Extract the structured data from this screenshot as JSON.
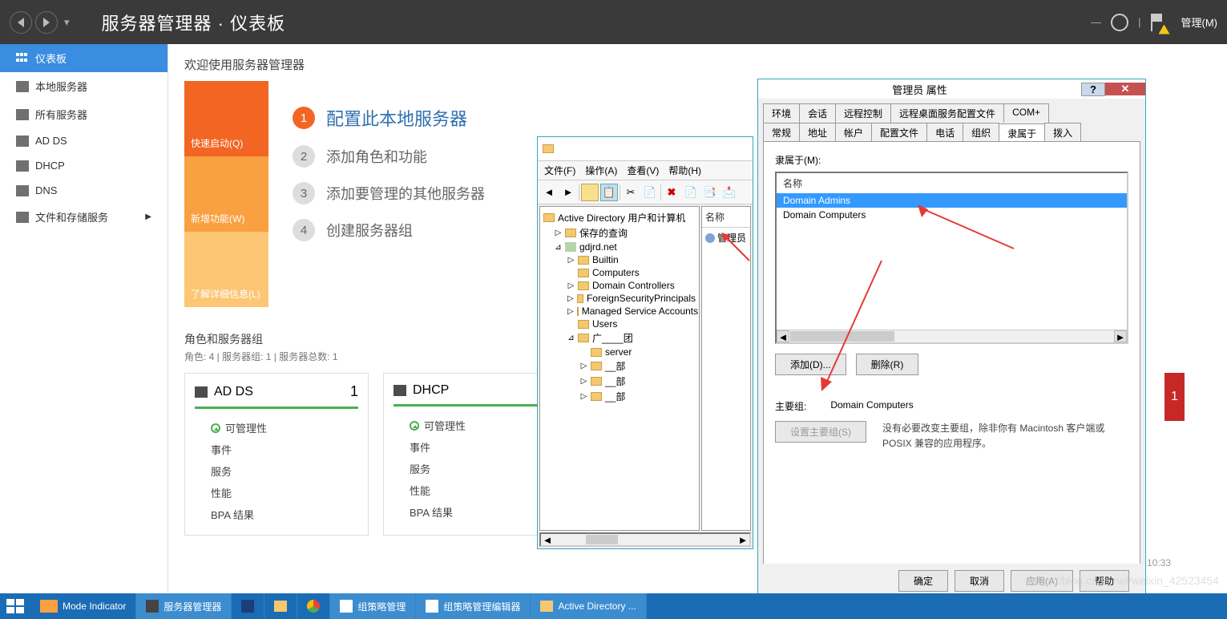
{
  "titlebar": {
    "breadcrumb_part1": "服务器管理器",
    "breadcrumb_sep": "·",
    "breadcrumb_part2": "仪表板",
    "manage": "管理(M)"
  },
  "sidebar": {
    "items": [
      {
        "label": "仪表板"
      },
      {
        "label": "本地服务器"
      },
      {
        "label": "所有服务器"
      },
      {
        "label": "AD DS"
      },
      {
        "label": "DHCP"
      },
      {
        "label": "DNS"
      },
      {
        "label": "文件和存储服务"
      }
    ]
  },
  "welcome": {
    "title": "欢迎使用服务器管理器",
    "tiles": [
      {
        "label": "快速启动(Q)"
      },
      {
        "label": "新增功能(W)"
      },
      {
        "label": "了解详细信息(L)"
      }
    ],
    "steps": [
      {
        "num": "1",
        "label": "配置此本地服务器"
      },
      {
        "num": "2",
        "label": "添加角色和功能"
      },
      {
        "num": "3",
        "label": "添加要管理的其他服务器"
      },
      {
        "num": "4",
        "label": "创建服务器组"
      }
    ]
  },
  "groups": {
    "title": "角色和服务器组",
    "sub": "角色: 4 | 服务器组: 1 | 服务器总数: 1",
    "cards": [
      {
        "title": "AD DS",
        "count": "1",
        "items": [
          "可管理性",
          "事件",
          "服务",
          "性能",
          "BPA 结果"
        ]
      },
      {
        "title": "DHCP",
        "count": "",
        "items": [
          "可管理性",
          "事件",
          "服务",
          "性能",
          "BPA 结果"
        ]
      }
    ],
    "red_count": "1"
  },
  "ad_window": {
    "menus": [
      "文件(F)",
      "操作(A)",
      "查看(V)",
      "帮助(H)"
    ],
    "tree_root": "Active Directory 用户和计算机",
    "right_head": "名称",
    "right_item": "管理员",
    "nodes": [
      "保存的查询",
      "gdjrd.net",
      "Builtin",
      "Computers",
      "Domain Controllers",
      "ForeignSecurityPrincipals",
      "Managed Service Accounts",
      "Users",
      "广____团",
      "server",
      "__部",
      "__部",
      "__部"
    ]
  },
  "props": {
    "title": "管理员 属性",
    "tabs_row1": [
      "环境",
      "会话",
      "远程控制",
      "远程桌面服务配置文件",
      "COM+"
    ],
    "tabs_row2": [
      "常规",
      "地址",
      "帐户",
      "配置文件",
      "电话",
      "组织",
      "隶属于",
      "拨入"
    ],
    "member_label": "隶属于(M):",
    "list_head": "名称",
    "members": [
      "Domain Admins",
      "Domain Computers"
    ],
    "add_btn": "添加(D)...",
    "del_btn": "删除(R)",
    "primary_label": "主要组:",
    "primary_value": "Domain Computers",
    "set_primary": "设置主要组(S)",
    "note": "没有必要改变主要组，除非你有 Macintosh 客户端或 POSIX 兼容的应用程序。",
    "ok": "确定",
    "cancel": "取消",
    "apply": "应用(A)",
    "help": "帮助"
  },
  "taskbar": {
    "mode": "Mode Indicator",
    "items": [
      "服务器管理器",
      "",
      "",
      "",
      "组策略管理",
      "",
      "组策略管理编辑器",
      "Active Directory ..."
    ],
    "time": "10:33"
  },
  "watermark": "https://blog.csdn.net/weixin_42523454"
}
